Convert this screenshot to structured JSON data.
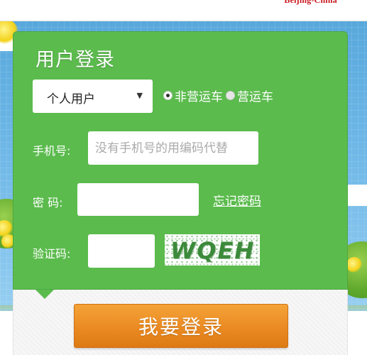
{
  "header": {
    "brand_text": "Beijing-China"
  },
  "login_panel": {
    "title": "用户登录",
    "user_type": {
      "selected": "个人用户",
      "caret": "▼"
    },
    "vehicle_type": {
      "options": [
        {
          "label": "非营运车",
          "checked": true
        },
        {
          "label": "营运车",
          "checked": false
        }
      ]
    },
    "phone": {
      "label": "手机号:",
      "placeholder": "没有手机号的用编码代替",
      "value": ""
    },
    "password": {
      "label": "密 码:",
      "value": "",
      "forgot_link": "忘记密码"
    },
    "captcha": {
      "label": "验证码:",
      "value": "",
      "image_text": "WQEH"
    },
    "submit_label": "我要登录"
  },
  "colors": {
    "panel_green": "#5bbb4d",
    "button_orange": "#ea8a22",
    "brand_red": "#c8161d"
  }
}
